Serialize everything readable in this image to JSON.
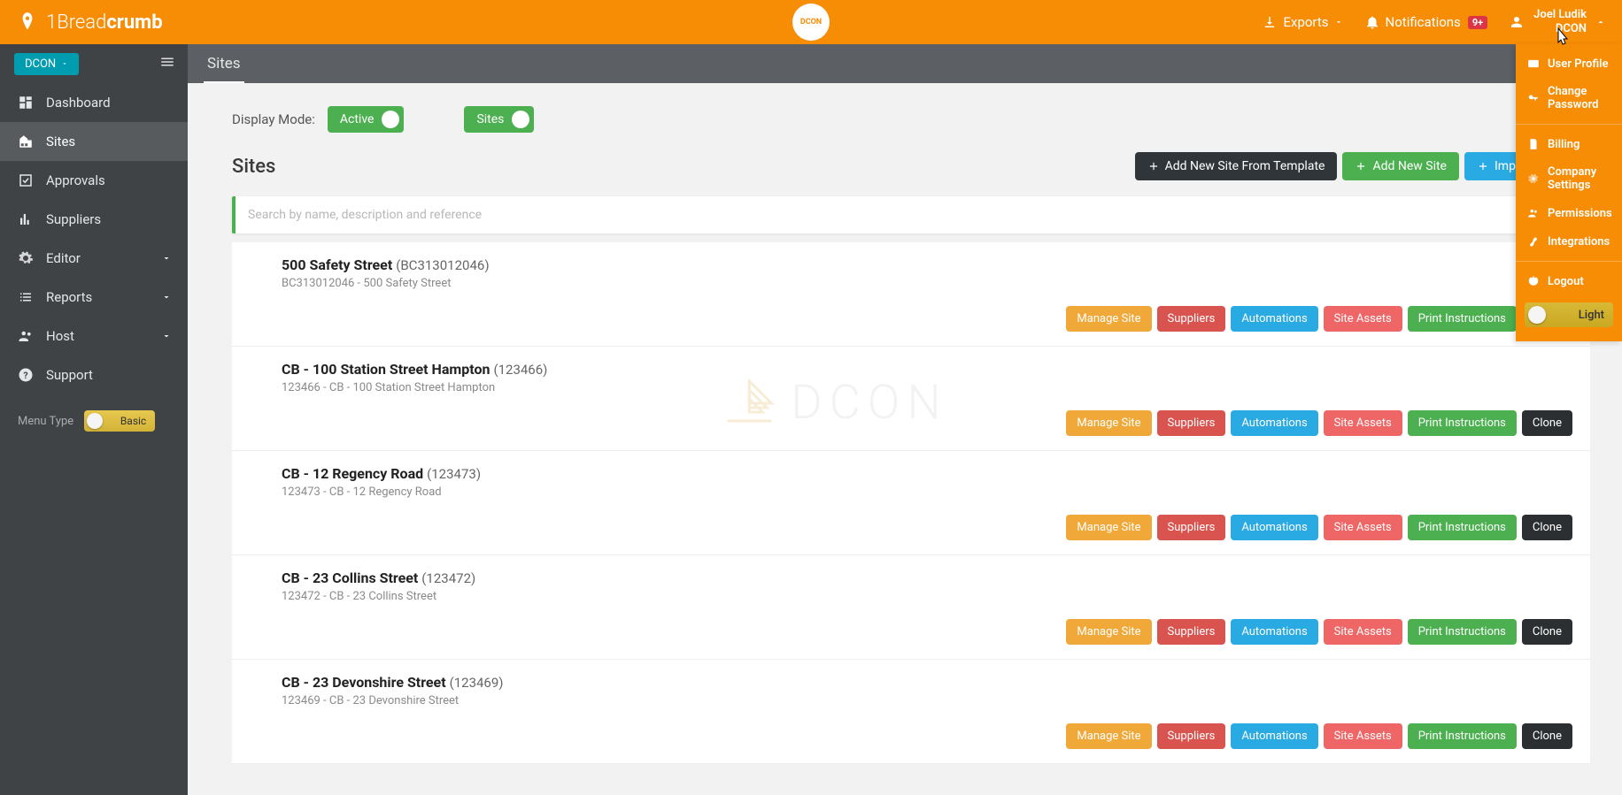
{
  "brand": {
    "prefix": "1Bread",
    "bold": "crumb"
  },
  "topCenterLogo": "DCON",
  "header": {
    "exports": "Exports",
    "notifications": "Notifications",
    "notificationsBadge": "9+",
    "userName": "Joel Ludik",
    "userCompany": "DCON"
  },
  "userMenu": {
    "userProfile": "User Profile",
    "changePassword": "Change Password",
    "billing": "Billing",
    "companySettings": "Company Settings",
    "permissions": "Permissions",
    "integrations": "Integrations",
    "logout": "Logout",
    "theme": "Light"
  },
  "sidebar": {
    "companyDropdown": "DCON",
    "items": [
      {
        "label": "Dashboard",
        "icon": "dashboard"
      },
      {
        "label": "Sites",
        "icon": "city",
        "active": true
      },
      {
        "label": "Approvals",
        "icon": "check-square"
      },
      {
        "label": "Suppliers",
        "icon": "bar-chart"
      },
      {
        "label": "Editor",
        "icon": "gear",
        "expandable": true
      },
      {
        "label": "Reports",
        "icon": "list",
        "expandable": true
      },
      {
        "label": "Host",
        "icon": "users",
        "expandable": true
      },
      {
        "label": "Support",
        "icon": "question"
      }
    ],
    "menuTypeLabel": "Menu Type",
    "menuTypeValue": "Basic"
  },
  "pageTab": "Sites",
  "displayMode": {
    "label": "Display Mode:",
    "toggle1": "Active",
    "toggle2": "Sites"
  },
  "sitesSection": {
    "title": "Sites",
    "buttons": {
      "addFromTemplate": "Add New Site From Template",
      "addNew": "Add New Site",
      "import": "Import Sites"
    },
    "searchPlaceholder": "Search by name, description and reference"
  },
  "siteActions": {
    "manage": "Manage Site",
    "suppliers": "Suppliers",
    "automations": "Automations",
    "assets": "Site Assets",
    "print": "Print Instructions",
    "clone": "Clone"
  },
  "sites": [
    {
      "name": "500 Safety Street",
      "ref": "(BC313012046)",
      "sub": "BC313012046 - 500 Safety Street"
    },
    {
      "name": "CB - 100 Station Street Hampton",
      "ref": "(123466)",
      "sub": "123466 - CB - 100 Station Street Hampton"
    },
    {
      "name": "CB - 12 Regency Road",
      "ref": "(123473)",
      "sub": "123473 - CB - 12 Regency Road"
    },
    {
      "name": "CB - 23 Collins Street",
      "ref": "(123472)",
      "sub": "123472 - CB - 23 Collins Street"
    },
    {
      "name": "CB - 23 Devonshire Street",
      "ref": "(123469)",
      "sub": "123469 - CB - 23 Devonshire Street"
    }
  ],
  "watermark": "DCON"
}
